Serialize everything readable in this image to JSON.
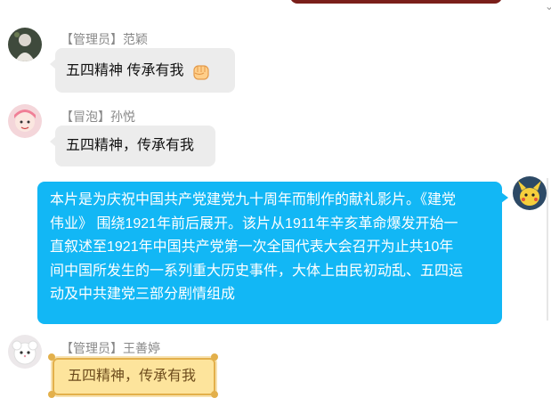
{
  "messages": [
    {
      "sender": "【管理员】范颖",
      "text": "五四精神 传承有我",
      "emoji": "raised-fist-icon",
      "avatar": "avatar-fanying"
    },
    {
      "sender": "【冒泡】孙悦",
      "text": "五四精神，传承有我",
      "avatar": "avatar-sunyue"
    },
    {
      "self": true,
      "lines": [
        "本片是为庆祝中国共产党建党九十周年而制作的献礼影片。《建党",
        "伟业》 围绕1921年前后展开。该片从1911年辛亥革命爆发开始一",
        "直叙述至1921年中国共产党第一次全国代表大会召开为止共10年",
        "间中国所发生的一系列重大历史事件，大体上由民初动乱、五四运",
        "动及中共建党三部分剧情组成"
      ],
      "avatar": "avatar-self"
    },
    {
      "sender": "【管理员】王善婷",
      "text": "五四精神，传承有我",
      "avatar": "avatar-wangshanting"
    }
  ],
  "colors": {
    "self_bubble": "#12b7f5",
    "other_bubble": "#ececec",
    "gold_bubble": "#fde49c",
    "gold_border": "#e3b04b"
  }
}
